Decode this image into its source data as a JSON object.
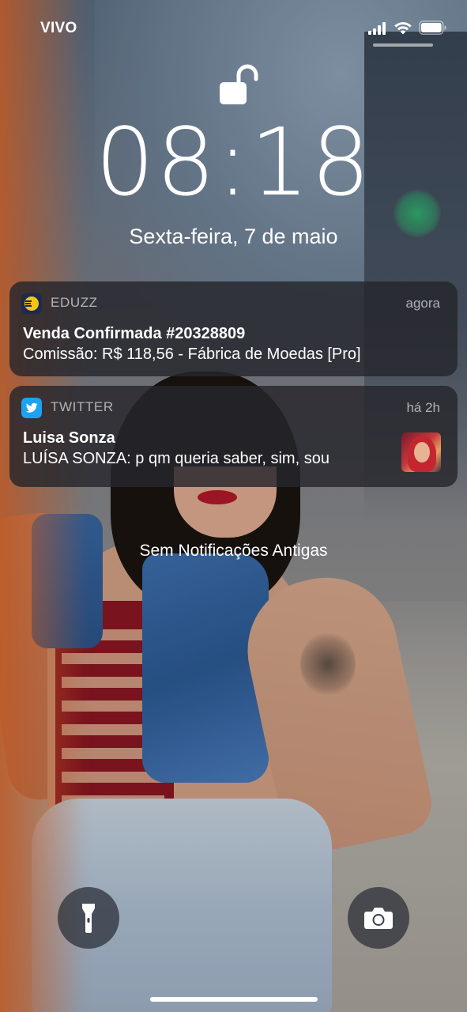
{
  "status_bar": {
    "carrier": "VIVO",
    "signal_icon": "cellular-signal-icon",
    "wifi_icon": "wifi-icon",
    "battery_icon": "battery-icon"
  },
  "lock_screen": {
    "lock_icon": "unlocked-padlock-icon",
    "time": "08:18",
    "date": "Sexta-feira, 7 de maio"
  },
  "notifications": [
    {
      "app": "EDUZZ",
      "time": "agora",
      "title": "Venda Confirmada #20328809",
      "body": "Comissão: R$ 118,56 - Fábrica de Moedas [Pro]",
      "icon": "eduzz-app-icon"
    },
    {
      "app": "TWITTER",
      "time": "há 2h",
      "title": "Luisa Sonza",
      "body": "LUÍSA SONZA: p qm queria saber, sim, sou",
      "icon": "twitter-app-icon",
      "thumbnail": "attached-photo-thumbnail"
    }
  ],
  "no_older_notifications": "Sem Notificações Antigas",
  "controls": {
    "flashlight": "flashlight-icon",
    "camera": "camera-icon"
  },
  "colors": {
    "twitter_blue": "#1da1f2",
    "eduzz_yellow": "#f5c518",
    "eduzz_navy": "#1b2a4e",
    "notification_bg": "rgba(38,38,44,0.82)"
  }
}
